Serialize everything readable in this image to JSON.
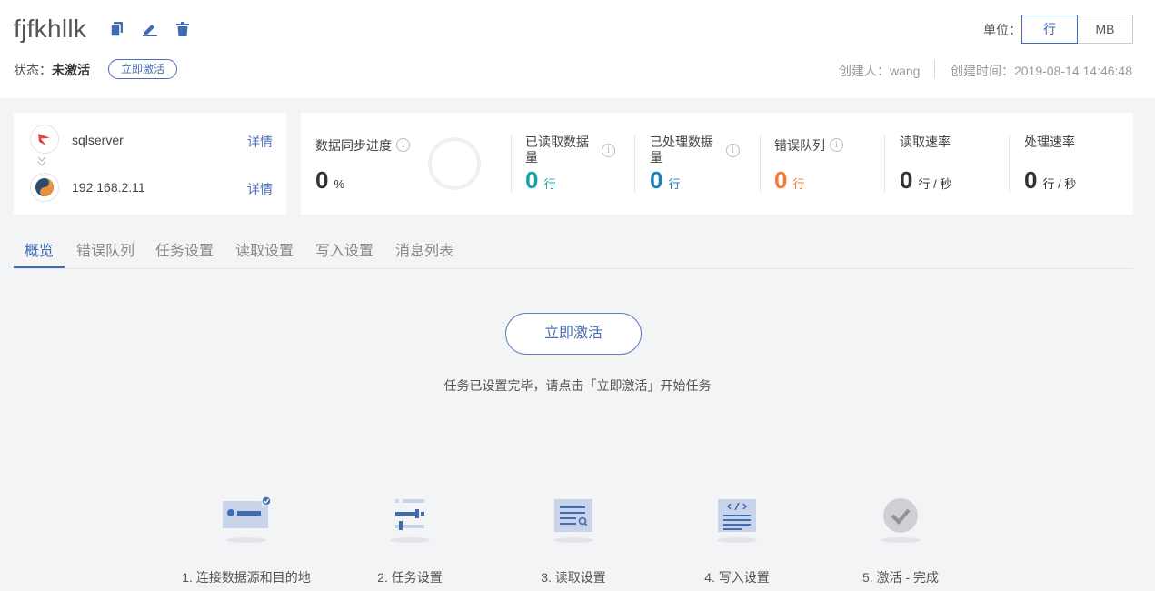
{
  "header": {
    "title": "fjfkhllk",
    "status_label": "状态：",
    "status_value": "未激活",
    "activate_small": "立即激活",
    "unit_label": "单位：",
    "unit_options": [
      "行",
      "MB"
    ],
    "unit_selected": "行",
    "creator_label": "创建人：",
    "creator_value": "wang",
    "created_time_label": "创建时间：",
    "created_time_value": "2019-08-14 14:46:48",
    "icons": [
      "copy-icon",
      "edit-icon",
      "delete-icon"
    ]
  },
  "connection": {
    "source": {
      "name": "sqlserver",
      "detail_label": "详情",
      "icon": "sqlserver-icon"
    },
    "target": {
      "name": "192.168.2.11",
      "detail_label": "详情",
      "icon": "database-icon"
    }
  },
  "stats": {
    "sync_progress": {
      "label": "数据同步进度",
      "value": "0",
      "unit": "%"
    },
    "read_count": {
      "label": "已读取数据量",
      "value": "0",
      "unit": "行",
      "color": "#1aa0a6"
    },
    "processed_count": {
      "label": "已处理数据量",
      "value": "0",
      "unit": "行",
      "color": "#1e7fb8"
    },
    "error_queue": {
      "label": "错误队列",
      "value": "0",
      "unit": "行",
      "color": "#f07a36"
    },
    "read_rate": {
      "label": "读取速率",
      "value": "0",
      "unit": "行 / 秒"
    },
    "process_rate": {
      "label": "处理速率",
      "value": "0",
      "unit": "行 / 秒"
    }
  },
  "tabs": [
    {
      "label": "概览",
      "active": true
    },
    {
      "label": "错误队列"
    },
    {
      "label": "任务设置"
    },
    {
      "label": "读取设置"
    },
    {
      "label": "写入设置"
    },
    {
      "label": "消息列表"
    }
  ],
  "main": {
    "activate_button": "立即激活",
    "hint": "任务已设置完毕，请点击「立即激活」开始任务"
  },
  "steps": [
    {
      "label": "1. 连接数据源和目的地",
      "icon": "connection-icon"
    },
    {
      "label": "2. 任务设置",
      "icon": "sliders-icon"
    },
    {
      "label": "3. 读取设置",
      "icon": "read-icon"
    },
    {
      "label": "4. 写入设置",
      "icon": "code-icon"
    },
    {
      "label": "5. 激活 - 完成",
      "icon": "check-icon"
    }
  ]
}
